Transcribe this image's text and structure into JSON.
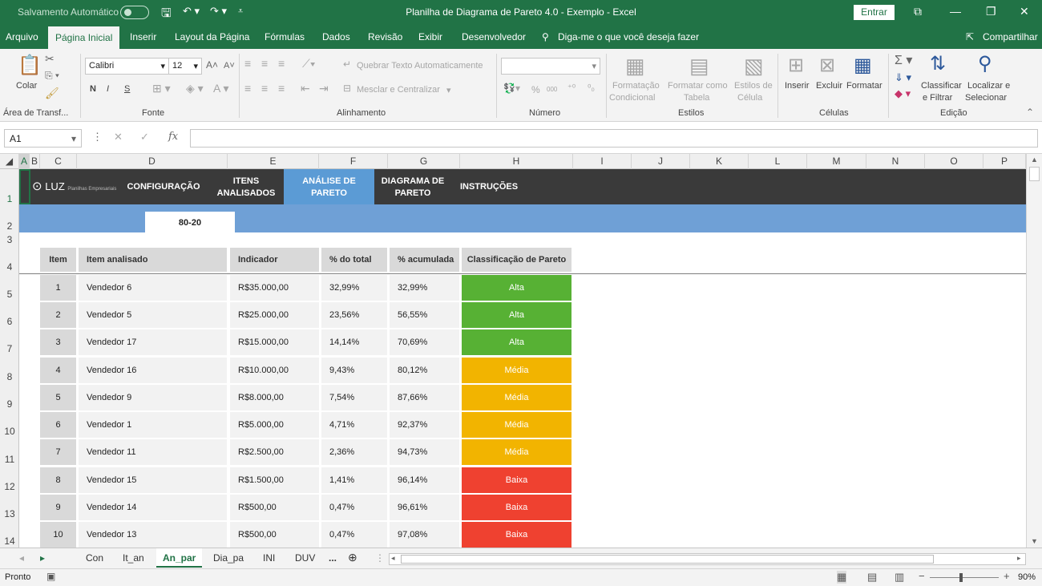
{
  "titlebar": {
    "autosave": "Salvamento Automático",
    "title": "Planilha de Diagrama de Pareto 4.0 - Exemplo  -  Excel",
    "signin": "Entrar"
  },
  "tabs": [
    "Arquivo",
    "Página Inicial",
    "Inserir",
    "Layout da Página",
    "Fórmulas",
    "Dados",
    "Revisão",
    "Exibir",
    "Desenvolvedor"
  ],
  "tell_me": "Diga-me o que você deseja fazer",
  "share": "Compartilhar",
  "ribbon": {
    "clipboard": {
      "paste": "Colar",
      "group": "Área de Transf..."
    },
    "font": {
      "name": "Calibri",
      "size": "12",
      "group": "Fonte",
      "bold": "N",
      "italic": "I",
      "underline": "S"
    },
    "alignment": {
      "wrap": "Quebrar Texto Automaticamente",
      "merge": "Mesclar e Centralizar",
      "group": "Alinhamento"
    },
    "number": {
      "percent": "%",
      "thousands": "000",
      "group": "Número"
    },
    "styles": {
      "cond1": "Formatação",
      "cond2": "Condicional",
      "table1": "Formatar como",
      "table2": "Tabela",
      "cell1": "Estilos de",
      "cell2": "Célula",
      "group": "Estilos"
    },
    "cells": {
      "insert": "Inserir",
      "delete": "Excluir",
      "format": "Formatar",
      "group": "Células"
    },
    "editing": {
      "sort1": "Classificar",
      "sort2": "e Filtrar",
      "find1": "Localizar e",
      "find2": "Selecionar",
      "group": "Edição"
    }
  },
  "formula_bar": {
    "name_box": "A1",
    "fx": "fx"
  },
  "columns": [
    "A",
    "B",
    "C",
    "D",
    "E",
    "F",
    "G",
    "H",
    "I",
    "J",
    "K",
    "L",
    "M",
    "N",
    "O",
    "P"
  ],
  "rows": [
    "1",
    "2",
    "3",
    "4",
    "5",
    "6",
    "7",
    "8",
    "9",
    "10",
    "11",
    "12",
    "13",
    "14"
  ],
  "sheet": {
    "logo": "LUZ",
    "logo_sub": "Planilhas Empresariais",
    "nav": [
      "CONFIGURAÇÃO",
      "ITENS\nANALISADOS",
      "ANÁLISE DE\nPARETO",
      "DIAGRAMA DE\nPARETO",
      "INSTRUÇÕES"
    ],
    "subtab": "80-20",
    "headers": [
      "Item",
      "Item analisado",
      "Indicador",
      "% do total",
      "% acumulada",
      "Classificação de Pareto"
    ],
    "data": [
      [
        "1",
        "Vendedor 6",
        "R$35.000,00",
        "32,99%",
        "32,99%",
        "Alta"
      ],
      [
        "2",
        "Vendedor 5",
        "R$25.000,00",
        "23,56%",
        "56,55%",
        "Alta"
      ],
      [
        "3",
        "Vendedor 17",
        "R$15.000,00",
        "14,14%",
        "70,69%",
        "Alta"
      ],
      [
        "4",
        "Vendedor 16",
        "R$10.000,00",
        "9,43%",
        "80,12%",
        "Média"
      ],
      [
        "5",
        "Vendedor 9",
        "R$8.000,00",
        "7,54%",
        "87,66%",
        "Média"
      ],
      [
        "6",
        "Vendedor 1",
        "R$5.000,00",
        "4,71%",
        "92,37%",
        "Média"
      ],
      [
        "7",
        "Vendedor 11",
        "R$2.500,00",
        "2,36%",
        "94,73%",
        "Média"
      ],
      [
        "8",
        "Vendedor 15",
        "R$1.500,00",
        "1,41%",
        "96,14%",
        "Baixa"
      ],
      [
        "9",
        "Vendedor 14",
        "R$500,00",
        "0,47%",
        "96,61%",
        "Baixa"
      ],
      [
        "10",
        "Vendedor 13",
        "R$500,00",
        "0,47%",
        "97,08%",
        "Baixa"
      ]
    ],
    "class_colors": {
      "Alta": "#57b134",
      "Média": "#f2b400",
      "Baixa": "#ef4130"
    }
  },
  "sheet_tabs": [
    "Con",
    "It_an",
    "An_par",
    "Dia_pa",
    "INI",
    "DUV",
    "..."
  ],
  "status": {
    "ready": "Pronto",
    "zoom": "90%"
  }
}
